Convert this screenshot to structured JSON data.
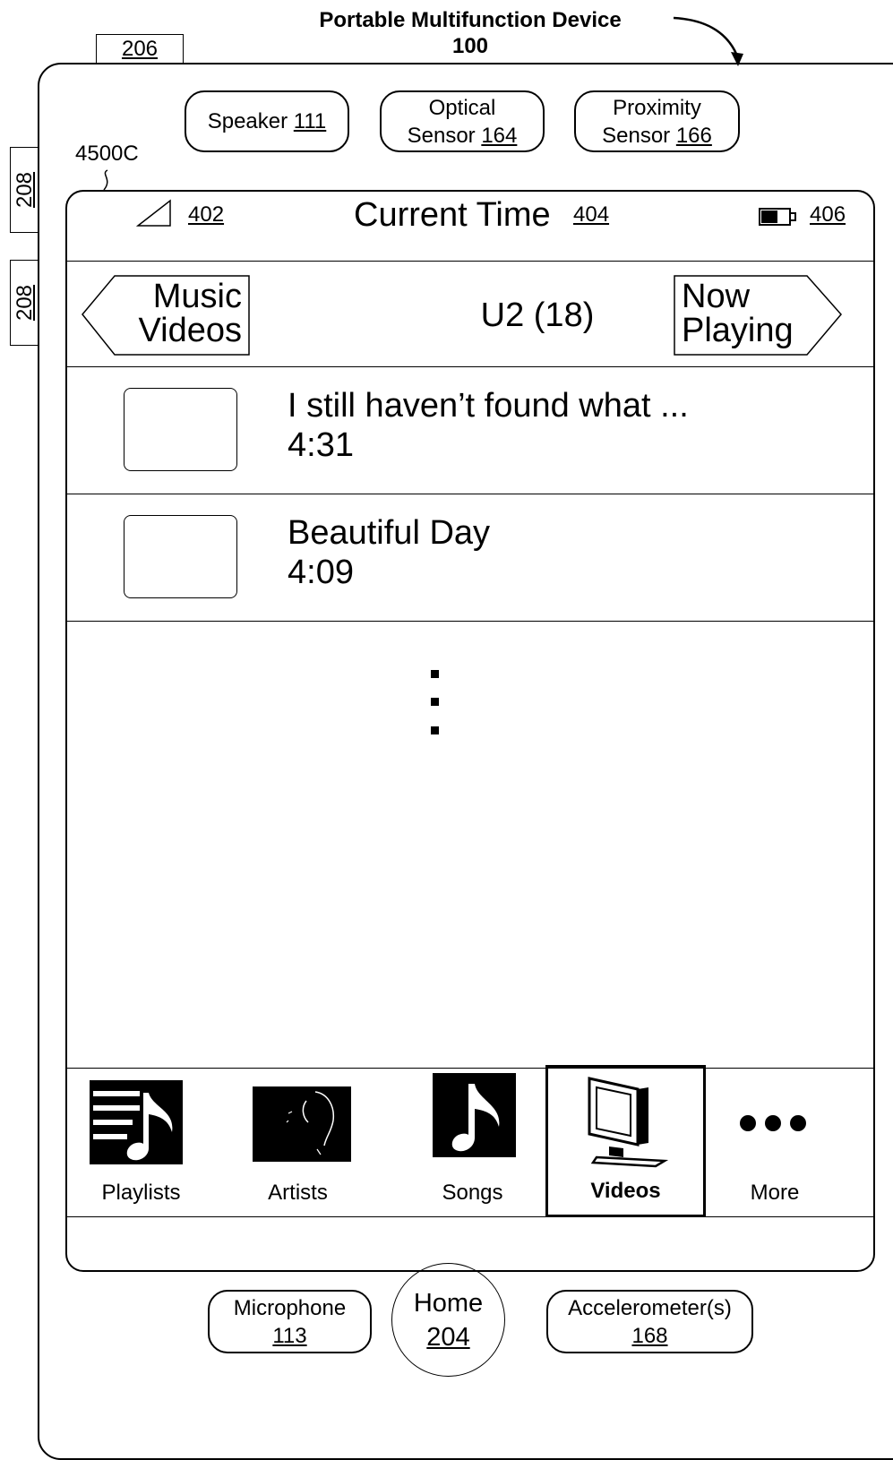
{
  "figure": {
    "title_line1": "Portable Multifunction Device",
    "title_line2": "100"
  },
  "side_tabs": {
    "top_ref": "206",
    "side_ref_1": "208",
    "side_ref_2": "208"
  },
  "sensors": {
    "speaker_label": "Speaker",
    "speaker_ref": "111",
    "optical_label_1": "Optical",
    "optical_label_2": "Sensor",
    "optical_ref": "164",
    "proximity_label_1": "Proximity",
    "proximity_label_2": "Sensor",
    "proximity_ref": "166"
  },
  "screen": {
    "ref": "4500C"
  },
  "status_bar": {
    "signal_ref": "402",
    "time_label": "Current Time",
    "time_ref": "404",
    "battery_ref": "406"
  },
  "nav_bar": {
    "back_line1": "Music",
    "back_line2": "Videos",
    "title": "U2 (18)",
    "forward_line1": "Now",
    "forward_line2": "Playing"
  },
  "videos": [
    {
      "title": "I still haven’t found what ...",
      "duration": "4:31"
    },
    {
      "title": "Beautiful Day",
      "duration": "4:09"
    }
  ],
  "tab_bar": {
    "items": [
      {
        "label": "Playlists",
        "icon": "playlists-icon"
      },
      {
        "label": "Artists",
        "icon": "artists-icon"
      },
      {
        "label": "Songs",
        "icon": "songs-icon"
      },
      {
        "label": "Videos",
        "icon": "videos-icon",
        "selected": true
      },
      {
        "label": "More",
        "icon": "more-icon"
      }
    ]
  },
  "bottom": {
    "microphone_label": "Microphone",
    "microphone_ref": "113",
    "home_label": "Home",
    "home_ref": "204",
    "accelerometer_label": "Accelerometer(s)",
    "accelerometer_ref": "168"
  }
}
